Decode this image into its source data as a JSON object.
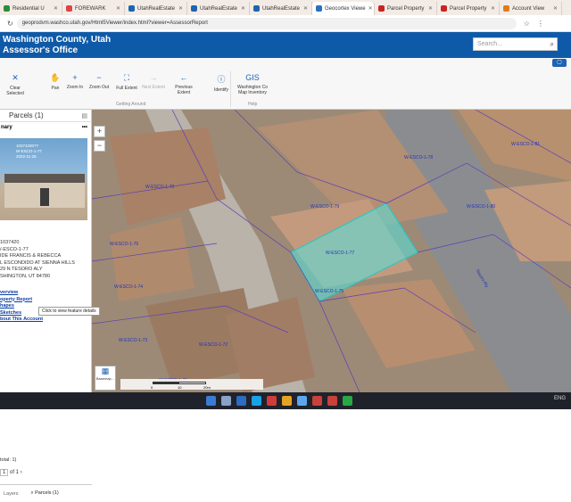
{
  "browser": {
    "tabs": [
      {
        "label": "Residential U",
        "color": "#2d8c3c"
      },
      {
        "label": "FOREWARK",
        "color": "#d44"
      },
      {
        "label": "UtahRealEstate",
        "color": "#1d64b3"
      },
      {
        "label": "UtahRealEstate",
        "color": "#1d64b3"
      },
      {
        "label": "UtahRealEstate",
        "color": "#1d64b3"
      },
      {
        "label": "Geocortex Viewe",
        "color": "#2a6fc1",
        "active": true
      },
      {
        "label": "Parcel Property",
        "color": "#cc2222"
      },
      {
        "label": "Parcel Property",
        "color": "#cc2222"
      },
      {
        "label": "Account View",
        "color": "#e07b1e"
      }
    ],
    "url": "geoprodvm.washco.utah.gov/Html5Viewer/index.html?viewer=AssessorReport"
  },
  "header": {
    "title_line1": "Washington County, Utah",
    "title_line2": "Assessor's Office",
    "search_placeholder": "Search...",
    "bg_color": "#0f5aa8"
  },
  "ribbon": {
    "buttons": [
      {
        "label": "Clear Selected",
        "icon": "close-icon",
        "glyph": "✕"
      },
      {
        "label": "Pan",
        "icon": "hand-icon",
        "glyph": "✋"
      },
      {
        "label": "Zoom In",
        "icon": "zoom-in-icon",
        "glyph": "+"
      },
      {
        "label": "Zoom Out",
        "icon": "zoom-out-icon",
        "glyph": "−"
      },
      {
        "label": "Full Extent",
        "icon": "full-extent-icon",
        "glyph": "⛶"
      },
      {
        "label": "Next Extent",
        "icon": "next-extent-icon",
        "glyph": "→"
      },
      {
        "label": "Previous Extent",
        "icon": "previous-extent-icon",
        "glyph": "←"
      },
      {
        "label": "Identify",
        "icon": "identify-icon",
        "glyph": "ⓘ"
      },
      {
        "label": "Washington Co Map Inventory",
        "icon": "gis-icon",
        "glyph": "GIS"
      }
    ],
    "groups": [
      "Getting Around",
      "Help"
    ]
  },
  "sidebar": {
    "panel_title": "Parcels (1)",
    "summary_label": "nary",
    "photo_caption": [
      "10374200??",
      "W-ESCO-1-77",
      "2022-11-25"
    ],
    "info_lines": [
      "1037420",
      "/-ESCO-1-77",
      "IDE FRANCIS & REBECCA",
      "L ESCONDIDO AT SIENNA HILLS",
      "29 N TESORO ALY",
      "SHINGTON, UT  84780"
    ],
    "links": [
      "verview",
      "operty Report",
      "hapes",
      "Sketches",
      "bout This Account"
    ],
    "tooltip": "Click to view feature details",
    "total_label": "total: 1)",
    "pager": "of 1",
    "bottom_tabs": [
      "Layers",
      "Parcels (1)"
    ]
  },
  "map": {
    "parcel_labels": [
      "W-ESCO-1-70",
      "W-ESCO-1-76",
      "W-ESCO-1-77",
      "W-ESCO-1-79",
      "W-ESCO-1-75",
      "W-ESCO-1-74",
      "W-ESCO-1-73",
      "W-ESCO-1-78",
      "W-ESCO-1-80",
      "W-ESCO-1-72",
      "W-ESCO-1-71",
      "W-ESCO-1-81",
      "Tesoro Aly"
    ],
    "basemap_label": "Basemap...",
    "scale_labels": [
      "0",
      "10",
      "20m"
    ],
    "highlight_color": "#54e6e0",
    "parcel_line_color": "#5b3fb5"
  },
  "taskbar": {
    "time": "ENG"
  }
}
